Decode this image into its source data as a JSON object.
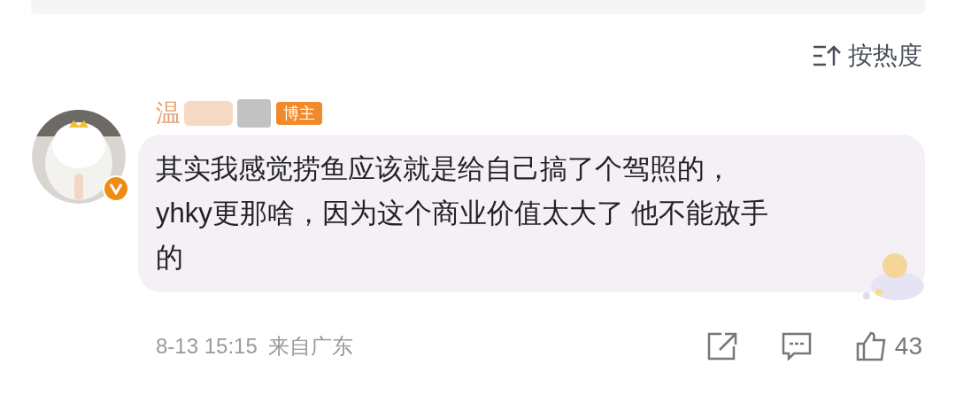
{
  "sort": {
    "label": "按热度"
  },
  "comment": {
    "author": "温",
    "badge": "博主",
    "verified": true,
    "lines": [
      "其实我感觉捞鱼应该就是给自己搞了个驾照的，",
      "yhky更那啥，因为这个商业价值太大了 他不能放手",
      "的"
    ],
    "date": "8-13 15:15",
    "location": "来自广东",
    "likes": "43"
  }
}
